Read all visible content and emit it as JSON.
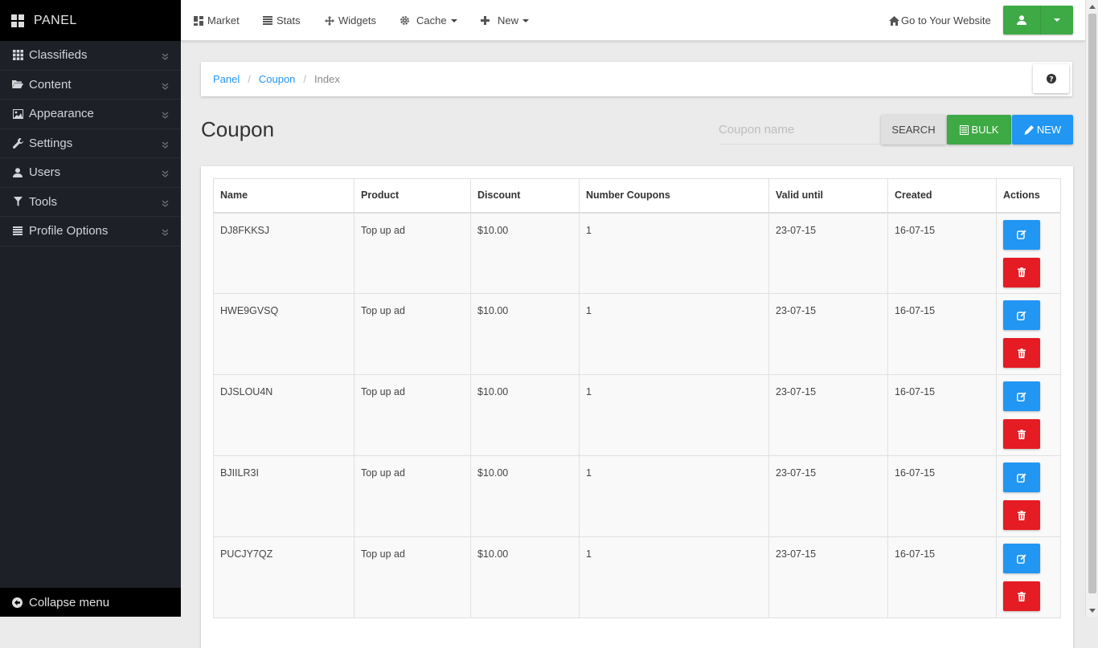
{
  "sidebar": {
    "brand": "PANEL",
    "items": [
      {
        "label": "Classifieds",
        "icon": "grid-icon"
      },
      {
        "label": "Content",
        "icon": "folder-open-icon"
      },
      {
        "label": "Appearance",
        "icon": "picture-icon"
      },
      {
        "label": "Settings",
        "icon": "wrench-icon"
      },
      {
        "label": "Users",
        "icon": "user-icon"
      },
      {
        "label": "Tools",
        "icon": "filter-icon"
      },
      {
        "label": "Profile Options",
        "icon": "list-icon"
      }
    ],
    "collapse_label": "Collapse menu"
  },
  "topbar": {
    "market": "Market",
    "stats": "Stats",
    "widgets": "Widgets",
    "cache": "Cache",
    "new": "New",
    "website": "Go to Your Website"
  },
  "breadcrumb": {
    "panel": "Panel",
    "coupon": "Coupon",
    "current": "Index"
  },
  "page": {
    "title": "Coupon",
    "search_placeholder": "Coupon name",
    "search_label": "SEARCH",
    "bulk_label": "BULK",
    "new_label": "NEW"
  },
  "table": {
    "headers": [
      "Name",
      "Product",
      "Discount",
      "Number Coupons",
      "Valid until",
      "Created",
      "Actions"
    ],
    "rows": [
      [
        "DJ8FKKSJ",
        "Top up ad",
        "$10.00",
        "1",
        "23-07-15",
        "16-07-15"
      ],
      [
        "HWE9GVSQ",
        "Top up ad",
        "$10.00",
        "1",
        "23-07-15",
        "16-07-15"
      ],
      [
        "DJSLOU4N",
        "Top up ad",
        "$10.00",
        "1",
        "23-07-15",
        "16-07-15"
      ],
      [
        "BJIILR3I",
        "Top up ad",
        "$10.00",
        "1",
        "23-07-15",
        "16-07-15"
      ],
      [
        "PUCJY7QZ",
        "Top up ad",
        "$10.00",
        "1",
        "23-07-15",
        "16-07-15"
      ]
    ]
  },
  "colors": {
    "sidebar_bg": "#1d2026",
    "primary": "#2196f3",
    "success": "#3eaa45",
    "danger": "#e51c23"
  }
}
